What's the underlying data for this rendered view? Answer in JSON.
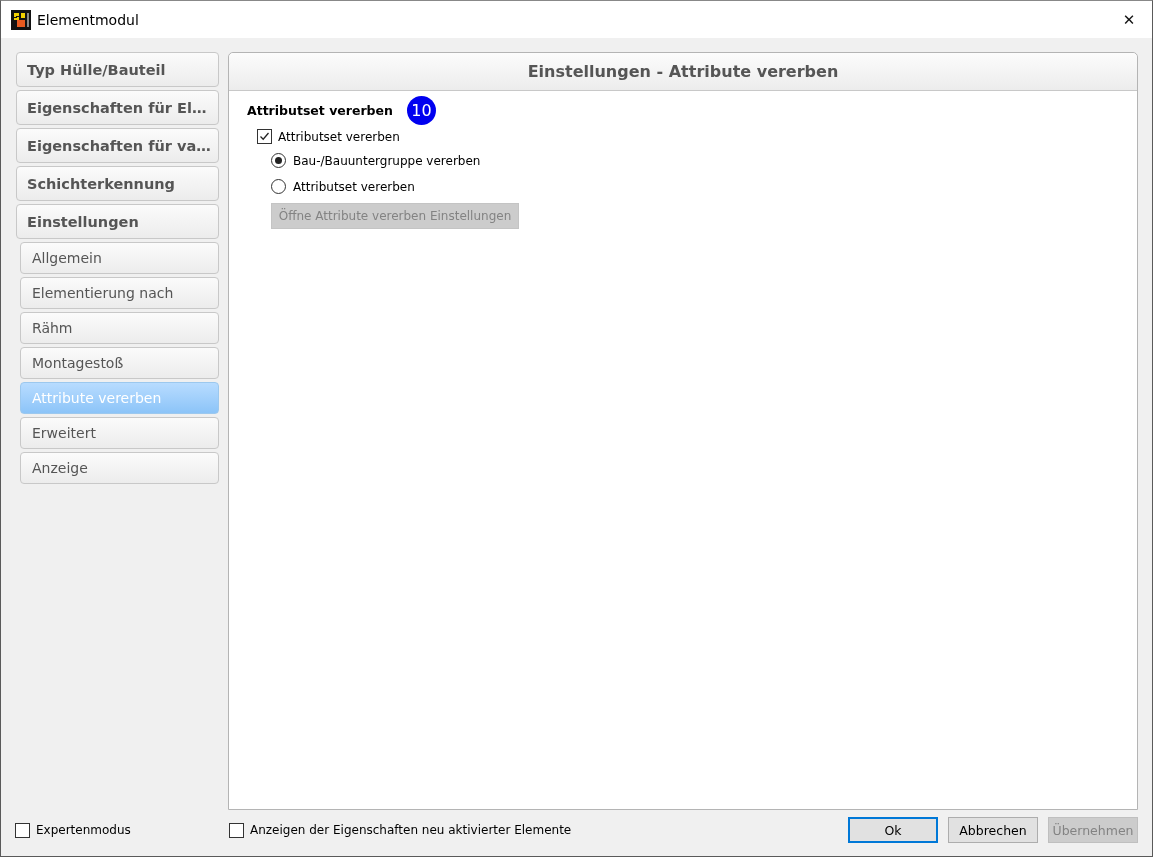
{
  "window": {
    "title": "Elementmodul",
    "close": "✕"
  },
  "sidebar": {
    "items": [
      {
        "label": "Typ Hülle/Bauteil",
        "kind": "group",
        "selected": false
      },
      {
        "label": "Eigenschaften für El…",
        "kind": "group",
        "selected": false
      },
      {
        "label": "Eigenschaften für va…",
        "kind": "group",
        "selected": false
      },
      {
        "label": "Schichterkennung",
        "kind": "group",
        "selected": false
      },
      {
        "label": "Einstellungen",
        "kind": "group",
        "selected": false
      },
      {
        "label": "Allgemein",
        "kind": "page",
        "selected": false
      },
      {
        "label": "Elementierung nach",
        "kind": "page",
        "selected": false
      },
      {
        "label": "Rähm",
        "kind": "page",
        "selected": false
      },
      {
        "label": "Montagestoß",
        "kind": "page",
        "selected": false
      },
      {
        "label": "Attribute vererben",
        "kind": "page",
        "selected": true
      },
      {
        "label": "Erweitert",
        "kind": "page",
        "selected": false
      },
      {
        "label": "Anzeige",
        "kind": "page",
        "selected": false
      }
    ],
    "expert_mode": {
      "label": "Expertenmodus",
      "checked": false
    }
  },
  "panel": {
    "title": "Einstellungen - Attribute vererben",
    "section": "Attributset vererben",
    "badge": "10",
    "checkbox": {
      "label": "Attributset vererben",
      "checked": true
    },
    "radios": [
      {
        "label": "Bau-/Bauuntergruppe vererben",
        "selected": true
      },
      {
        "label": "Attributset vererben",
        "selected": false
      }
    ],
    "button": {
      "label": "Öffne Attribute vererben Einstellungen",
      "disabled": true
    }
  },
  "footer": {
    "checkbox": {
      "label": "Anzeigen der Eigenschaften neu aktivierter Elemente",
      "checked": false
    },
    "buttons": [
      {
        "label": "Ok",
        "default": true,
        "disabled": false
      },
      {
        "label": "Abbrechen",
        "default": false,
        "disabled": false
      },
      {
        "label": "Übernehmen",
        "default": false,
        "disabled": true
      }
    ]
  }
}
